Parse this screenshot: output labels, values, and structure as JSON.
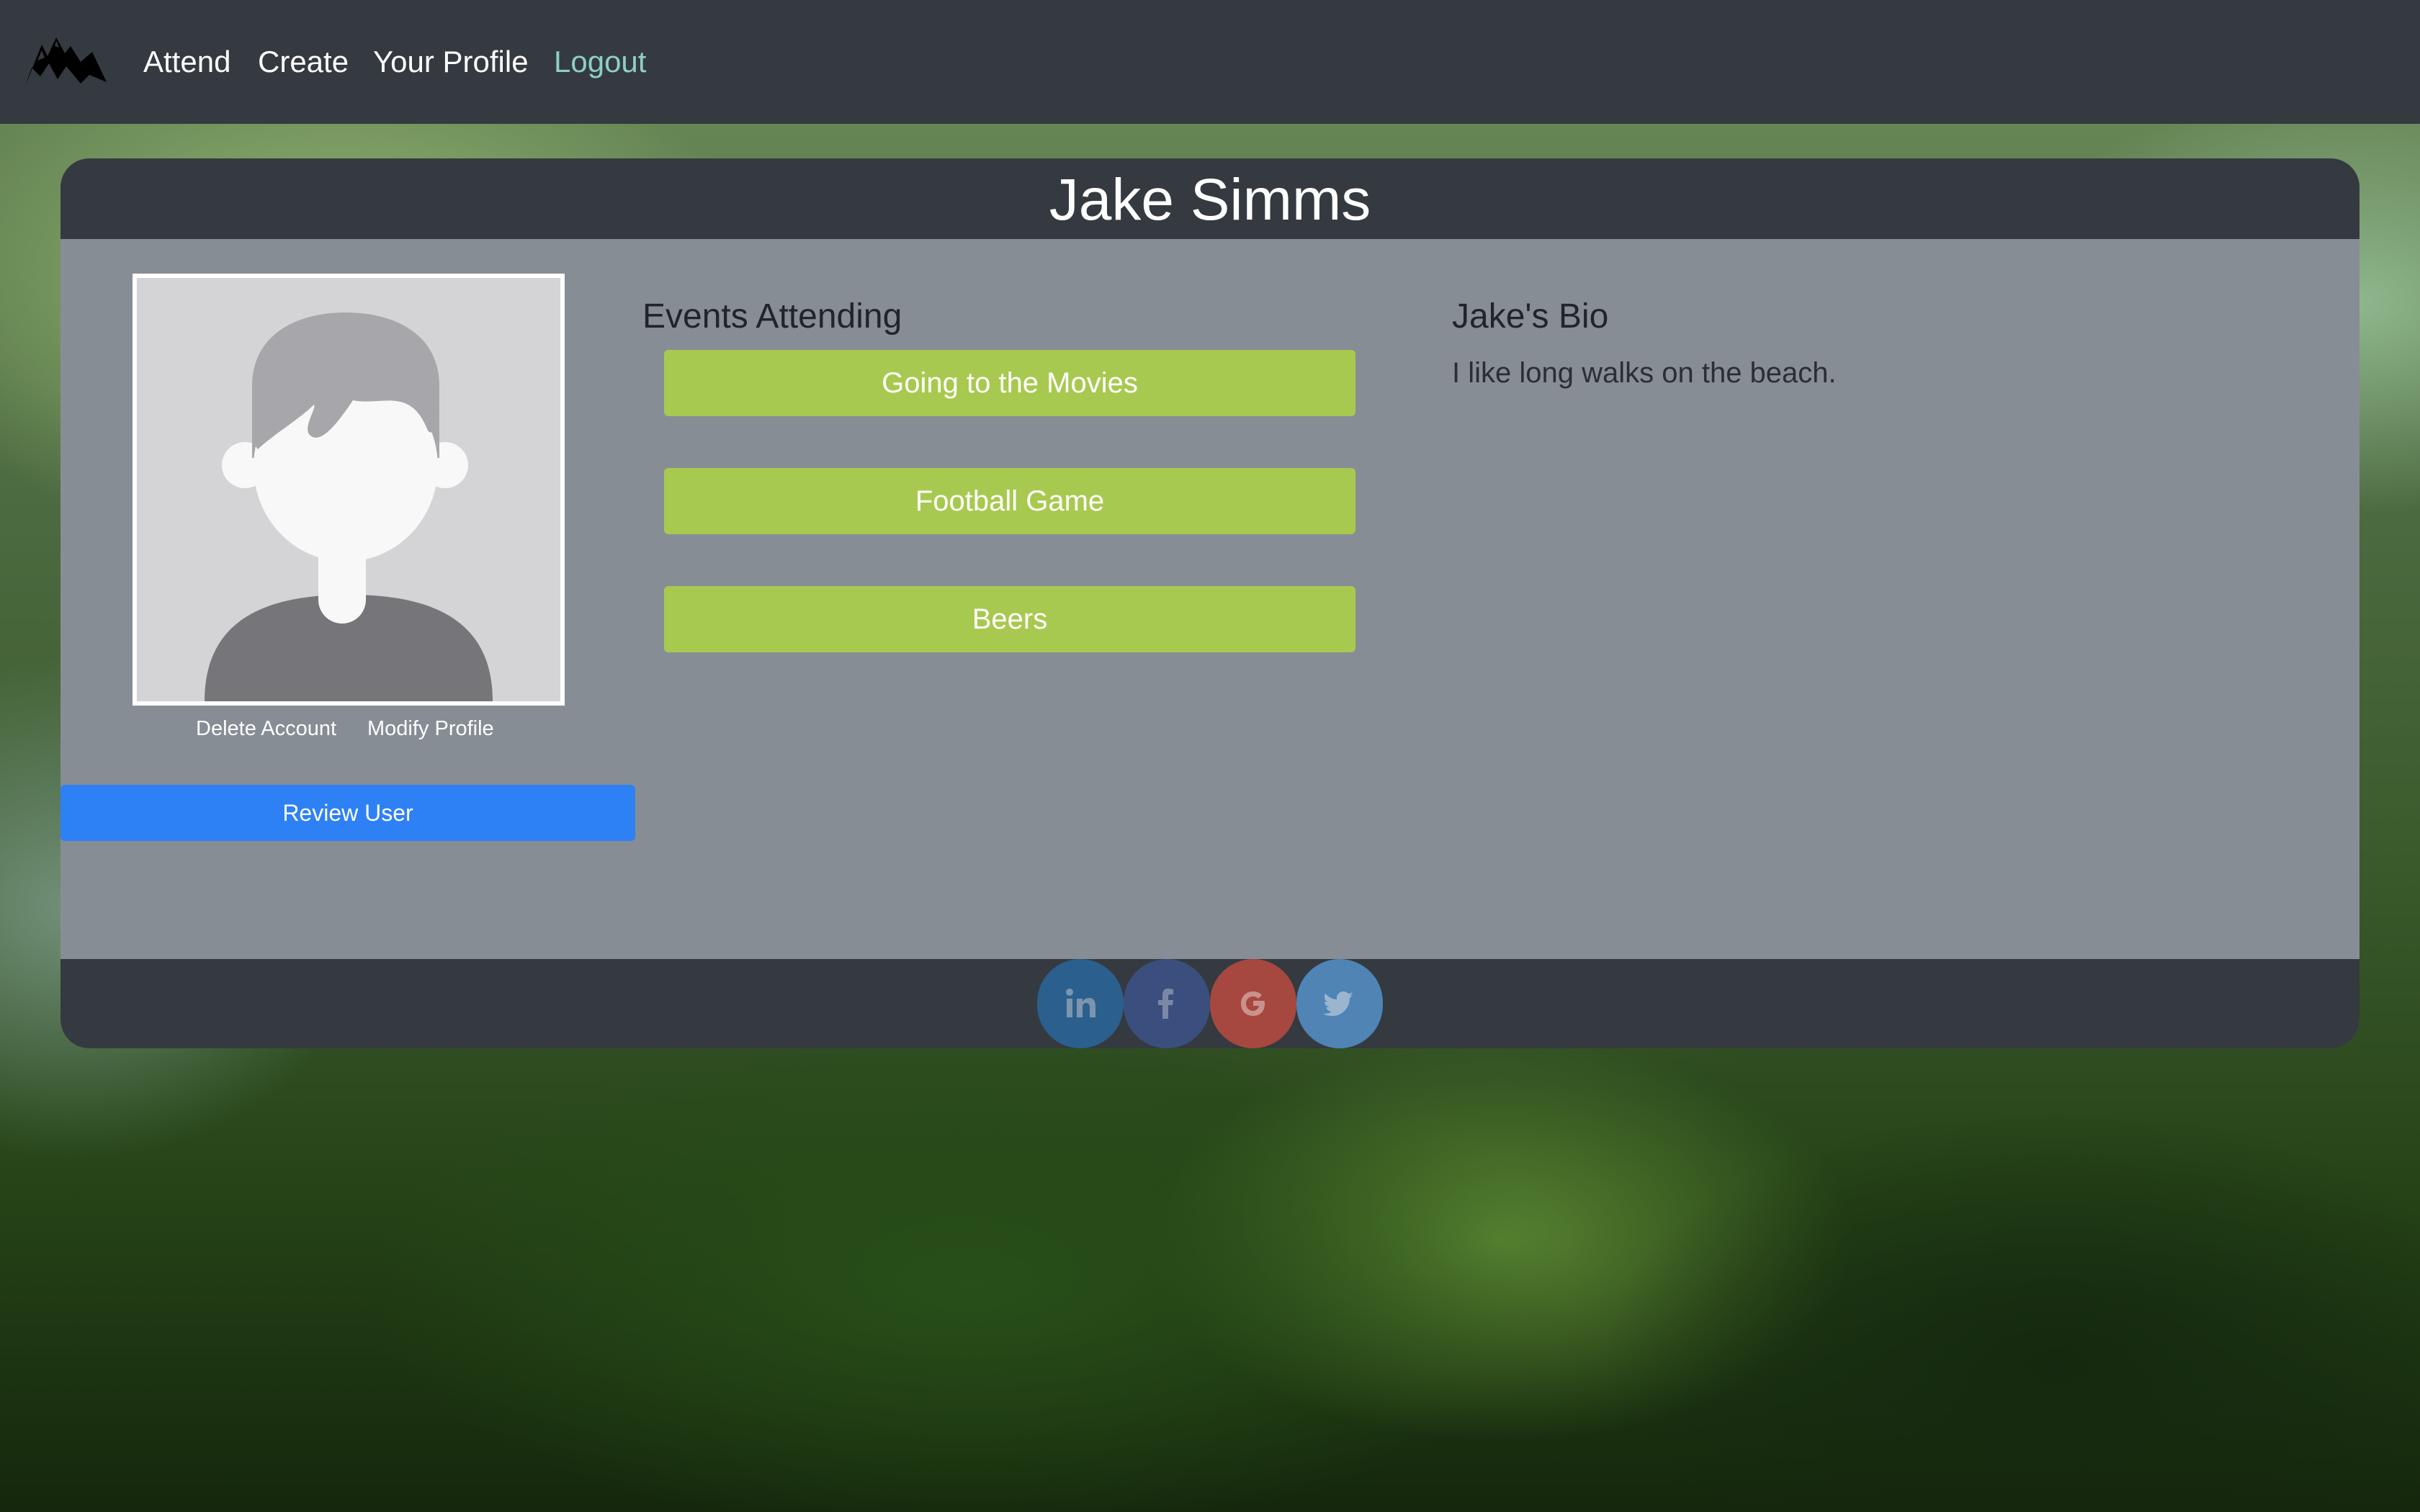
{
  "nav": {
    "logo": "mountain-logo",
    "links": [
      "Attend",
      "Create",
      "Your Profile",
      "Logout"
    ]
  },
  "profile": {
    "name": "Jake Simms",
    "avatar": "default-user-avatar",
    "actions": {
      "delete": "Delete Account",
      "modify": "Modify Profile",
      "review": "Review User"
    },
    "events_title": "Events Attending",
    "events": [
      "Going to the Movies",
      "Football Game",
      "Beers"
    ],
    "bio_title": "Jake's Bio",
    "bio": "I like long walks on the beach."
  },
  "social": [
    {
      "name": "linkedin-icon",
      "color": "#2b5f8d"
    },
    {
      "name": "facebook-icon",
      "color": "#3b4f7e"
    },
    {
      "name": "google-icon",
      "color": "#a6483f"
    },
    {
      "name": "twitter-icon",
      "color": "#4f84b5"
    }
  ],
  "colors": {
    "navbar": "#343a40",
    "card_body": "#878d95",
    "event_button": "#a8c94f",
    "review_button": "#2e80f5",
    "logout_link": "#8fcfc2"
  }
}
